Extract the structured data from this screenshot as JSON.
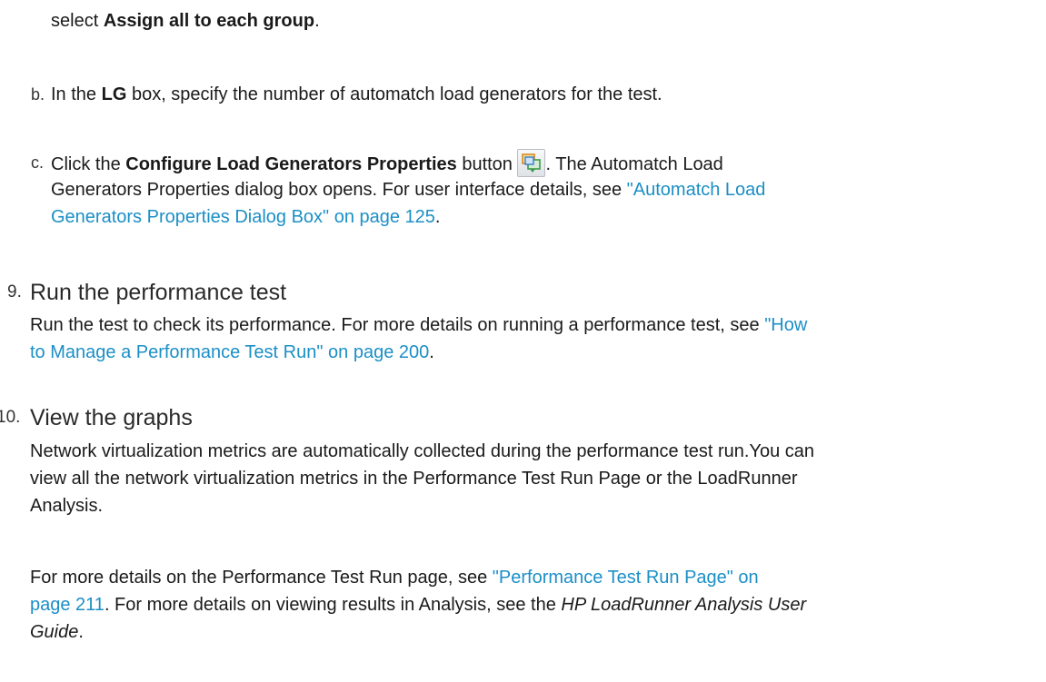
{
  "step_a_tail": {
    "prefix": "select ",
    "bold": "Assign all to each group",
    "suffix": "."
  },
  "step_b": {
    "marker": "b.",
    "prefix": "In the ",
    "bold": "LG",
    "suffix": " box, specify the number of automatch load generators for the test."
  },
  "step_c": {
    "marker": "c.",
    "line1_prefix": "Click the ",
    "line1_bold": "Configure Load Generators Properties",
    "line1_mid": " button ",
    "button_icon": "configure-load-generators-properties-icon",
    "line1_suffix": ". The Automatch Load",
    "line2_text": "Generators Properties dialog box opens. For user interface details, see ",
    "line2_link": "\"Automatch Load",
    "line3_link": "Generators Properties Dialog Box\" on page 125",
    "line3_suffix": "."
  },
  "step_9": {
    "number": "9.",
    "heading": "Run the performance test",
    "line1_text": "Run the test to check its performance. For more details on running a performance test, see ",
    "line1_link": "\"How",
    "line2_link": "to Manage a Performance Test Run\" on page 200",
    "line2_suffix": "."
  },
  "step_10": {
    "number": "10.",
    "heading": "View the graphs",
    "para1_line1": "Network virtualization metrics are automatically collected during the performance test run.You can",
    "para1_line2": "view all the network virtualization metrics in the Performance Test Run Page or the LoadRunner",
    "para1_line3": "Analysis.",
    "para2_line1_text": "For more details on the Performance Test Run page, see ",
    "para2_line1_link": "\"Performance Test Run Page\" on",
    "para2_line2_link": "page 211",
    "para2_line2_text": ". For more details on viewing results in Analysis, see the ",
    "para2_line2_italic": "HP LoadRunner Analysis User",
    "para2_line3_italic": "Guide",
    "para2_line3_suffix": "."
  },
  "colors": {
    "link": "#1b8fc6",
    "text": "#1a1a1a"
  }
}
